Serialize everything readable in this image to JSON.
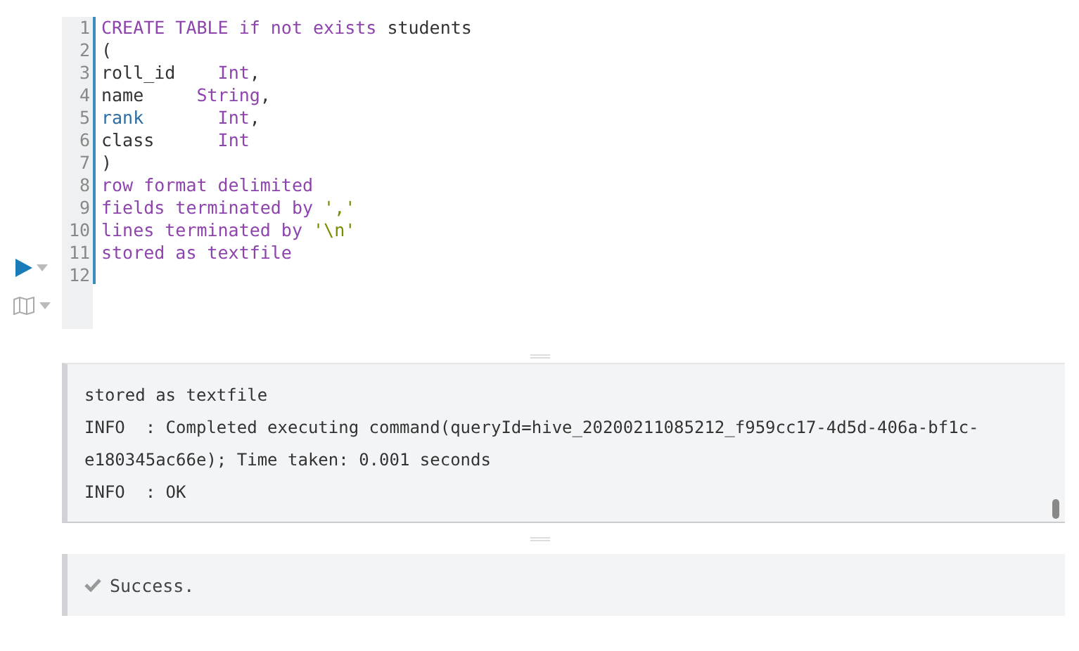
{
  "editor": {
    "lines": [
      {
        "number": "1",
        "tokens": [
          {
            "kind": "keyword",
            "text": "CREATE TABLE if not exists"
          },
          {
            "kind": "plain",
            "text": " students"
          }
        ]
      },
      {
        "number": "2",
        "tokens": [
          {
            "kind": "plain",
            "text": "("
          }
        ]
      },
      {
        "number": "3",
        "tokens": [
          {
            "kind": "plain",
            "text": "roll_id    "
          },
          {
            "kind": "keyword",
            "text": "Int"
          },
          {
            "kind": "plain",
            "text": ","
          }
        ]
      },
      {
        "number": "4",
        "tokens": [
          {
            "kind": "plain",
            "text": "name     "
          },
          {
            "kind": "keyword",
            "text": "String"
          },
          {
            "kind": "plain",
            "text": ","
          }
        ]
      },
      {
        "number": "5",
        "tokens": [
          {
            "kind": "variable",
            "text": "rank       "
          },
          {
            "kind": "keyword",
            "text": "Int"
          },
          {
            "kind": "plain",
            "text": ","
          }
        ]
      },
      {
        "number": "6",
        "tokens": [
          {
            "kind": "plain",
            "text": "class      "
          },
          {
            "kind": "keyword",
            "text": "Int"
          }
        ]
      },
      {
        "number": "7",
        "tokens": [
          {
            "kind": "plain",
            "text": ")"
          }
        ]
      },
      {
        "number": "8",
        "tokens": [
          {
            "kind": "keyword",
            "text": "row format delimited"
          }
        ]
      },
      {
        "number": "9",
        "tokens": [
          {
            "kind": "keyword",
            "text": "fields terminated by "
          },
          {
            "kind": "string",
            "text": "','"
          }
        ]
      },
      {
        "number": "10",
        "tokens": [
          {
            "kind": "keyword",
            "text": "lines terminated by "
          },
          {
            "kind": "string",
            "text": "'\\n'"
          }
        ]
      },
      {
        "number": "11",
        "tokens": [
          {
            "kind": "keyword",
            "text": "stored as textfile"
          }
        ]
      },
      {
        "number": "12"
      }
    ]
  },
  "log": {
    "lines": [
      "stored as textfile",
      "INFO  : Completed executing command(queryId=hive_20200211085212_f959cc17-4d5d-406a-bf1c-",
      "e180345ac66e); Time taken: 0.001 seconds",
      "INFO  : OK"
    ]
  },
  "status": {
    "message": "Success."
  }
}
